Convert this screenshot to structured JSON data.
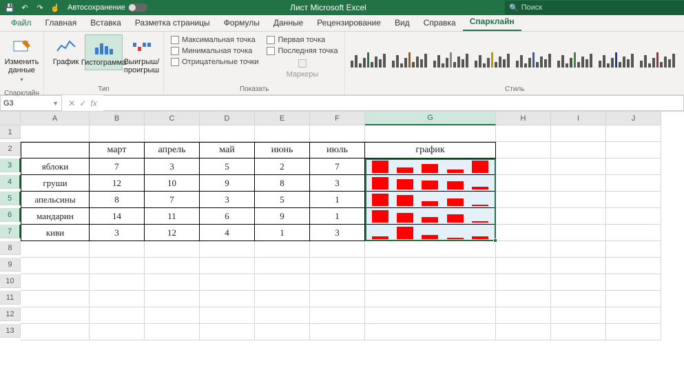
{
  "titlebar": {
    "autosave_label": "Автосохранение",
    "title": "Лист Microsoft Excel",
    "search_placeholder": "Поиск"
  },
  "tabs": {
    "file": "Файл",
    "home": "Главная",
    "insert": "Вставка",
    "layout": "Разметка страницы",
    "formulas": "Формулы",
    "data": "Данные",
    "review": "Рецензирование",
    "view": "Вид",
    "help": "Справка",
    "sparkline": "Спарклайн"
  },
  "ribbon": {
    "group_sparkline": "Спарклайн",
    "group_type": "Тип",
    "group_show": "Показать",
    "group_style": "Стиль",
    "edit_data": "Изменить данные",
    "line": "График",
    "column": "Гистограмма",
    "winloss": "Выигрыш/\nпроигрыш",
    "high_point": "Максимальная точка",
    "low_point": "Минимальная точка",
    "neg_points": "Отрицательные точки",
    "first_point": "Первая точка",
    "last_point": "Последняя точка",
    "markers": "Маркеры"
  },
  "namebox": "G3",
  "columns": [
    "A",
    "B",
    "C",
    "D",
    "E",
    "F",
    "G",
    "H",
    "I",
    "J"
  ],
  "headers": {
    "B": "март",
    "C": "апрель",
    "D": "май",
    "E": "июнь",
    "F": "июль",
    "G": "график"
  },
  "rows": [
    {
      "name": "яблоки",
      "vals": [
        7,
        3,
        5,
        2,
        7
      ]
    },
    {
      "name": "груши",
      "vals": [
        12,
        10,
        9,
        8,
        3
      ]
    },
    {
      "name": "апельсины",
      "vals": [
        8,
        7,
        3,
        5,
        1
      ]
    },
    {
      "name": "мандарин",
      "vals": [
        14,
        11,
        6,
        9,
        1
      ]
    },
    {
      "name": "киви",
      "vals": [
        3,
        12,
        4,
        1,
        3
      ]
    }
  ],
  "chart_data": {
    "type": "bar",
    "note": "Each row is a separate column-sparkline in column G; x = months, y = value",
    "categories": [
      "март",
      "апрель",
      "май",
      "июнь",
      "июль"
    ],
    "series": [
      {
        "name": "яблоки",
        "values": [
          7,
          3,
          5,
          2,
          7
        ]
      },
      {
        "name": "груши",
        "values": [
          12,
          10,
          9,
          8,
          3
        ]
      },
      {
        "name": "апельсины",
        "values": [
          8,
          7,
          3,
          5,
          1
        ]
      },
      {
        "name": "мандарин",
        "values": [
          14,
          11,
          6,
          9,
          1
        ]
      },
      {
        "name": "киви",
        "values": [
          3,
          12,
          4,
          1,
          3
        ]
      }
    ],
    "ylim": [
      0,
      14
    ],
    "bar_color": "#ff0000"
  },
  "style_thumbs_accent": [
    "#3a6b4a",
    "#a05a00",
    "#888",
    "#b89a00",
    "#3a5aa0",
    "#3a8a3a",
    "#204080",
    "#a03030"
  ]
}
